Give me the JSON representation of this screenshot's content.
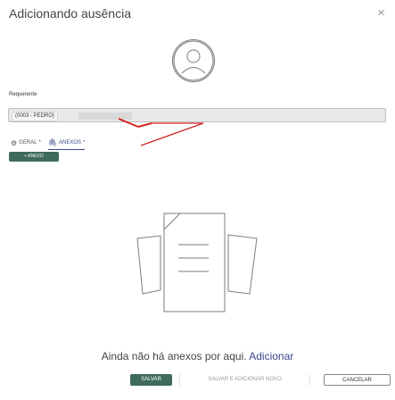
{
  "dialog": {
    "title": "Adicionando ausência",
    "close_icon": "×"
  },
  "form": {
    "requerente_label": "Requerente",
    "requerente_value": "(0003 - PEDRO)"
  },
  "tabs": [
    {
      "label": "GERAL",
      "required": "*",
      "icon": "gear-icon"
    },
    {
      "label": "ANEXOS",
      "required": "*",
      "icon": "paperclip-icon",
      "active": true
    }
  ],
  "annex": {
    "add_button": "+ ANEXO",
    "empty_text": "Ainda não há anexos por aqui.",
    "empty_link": "Adicionar"
  },
  "footer": {
    "save": "SALVAR",
    "save_and_new": "SALVAR E ADICIONAR NOVO",
    "cancel": "CANCELAR"
  },
  "colors": {
    "primary_green": "#3f6b5a",
    "accent_blue": "#3b4a8c",
    "annotation_red": "#d22222"
  }
}
